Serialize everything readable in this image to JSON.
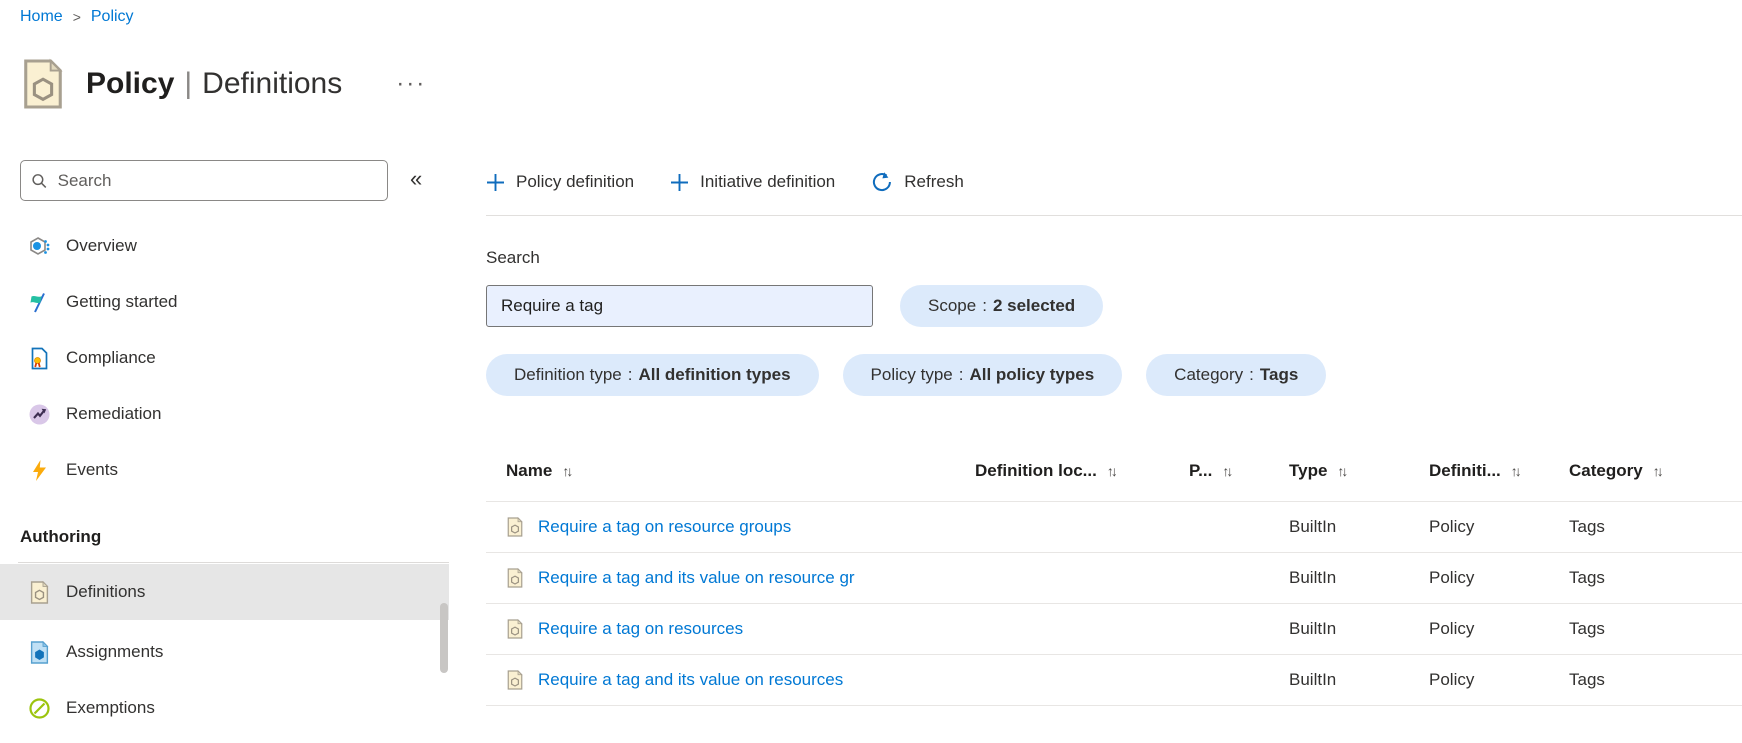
{
  "colors": {
    "accent": "#0078d4",
    "pill_background": "#dceafb",
    "selected_item_background": "#e6e6e6",
    "search_input_background": "#e9f0fe"
  },
  "icons": {
    "breadcrumb_separator": ">",
    "more": "···",
    "collapse": "«",
    "plus": "+",
    "sort": "↑↓"
  },
  "breadcrumb": {
    "items": [
      {
        "label": "Home"
      },
      {
        "label": "Policy"
      }
    ]
  },
  "page": {
    "title_primary": "Policy",
    "title_separator": "|",
    "title_secondary": "Definitions"
  },
  "sidebar": {
    "search": {
      "placeholder": "Search"
    },
    "items": [
      {
        "label": "Overview",
        "icon": "overview-icon"
      },
      {
        "label": "Getting started",
        "icon": "getting-started-icon"
      },
      {
        "label": "Compliance",
        "icon": "compliance-icon"
      },
      {
        "label": "Remediation",
        "icon": "remediation-icon"
      },
      {
        "label": "Events",
        "icon": "events-icon"
      }
    ],
    "section_label": "Authoring",
    "authoring_items": [
      {
        "label": "Definitions",
        "icon": "definitions-icon",
        "selected": true
      },
      {
        "label": "Assignments",
        "icon": "assignments-icon",
        "selected": false
      },
      {
        "label": "Exemptions",
        "icon": "exemptions-icon",
        "selected": false
      }
    ]
  },
  "toolbar": {
    "buttons": [
      {
        "label": "Policy definition",
        "icon": "plus-icon"
      },
      {
        "label": "Initiative definition",
        "icon": "plus-icon"
      },
      {
        "label": "Refresh",
        "icon": "refresh-icon"
      }
    ]
  },
  "filters": {
    "search_label": "Search",
    "search_value": "Require a tag",
    "separator": ":",
    "scope_pill": {
      "name": "Scope",
      "value": "2 selected"
    },
    "pills": [
      {
        "name": "Definition type",
        "value": "All definition types"
      },
      {
        "name": "Policy type",
        "value": "All policy types"
      },
      {
        "name": "Category",
        "value": "Tags"
      }
    ]
  },
  "table": {
    "columns": [
      {
        "label": "Name"
      },
      {
        "label": "Definition loc..."
      },
      {
        "label": "P..."
      },
      {
        "label": "Type"
      },
      {
        "label": "Definiti..."
      },
      {
        "label": "Category"
      }
    ],
    "rows": [
      {
        "name": "Require a tag on resource groups",
        "definition_location": "",
        "policies": "",
        "type": "BuiltIn",
        "definition_type": "Policy",
        "category": "Tags"
      },
      {
        "name": "Require a tag and its value on resource gr",
        "definition_location": "",
        "policies": "",
        "type": "BuiltIn",
        "definition_type": "Policy",
        "category": "Tags"
      },
      {
        "name": "Require a tag on resources",
        "definition_location": "",
        "policies": "",
        "type": "BuiltIn",
        "definition_type": "Policy",
        "category": "Tags"
      },
      {
        "name": "Require a tag and its value on resources",
        "definition_location": "",
        "policies": "",
        "type": "BuiltIn",
        "definition_type": "Policy",
        "category": "Tags"
      }
    ]
  }
}
